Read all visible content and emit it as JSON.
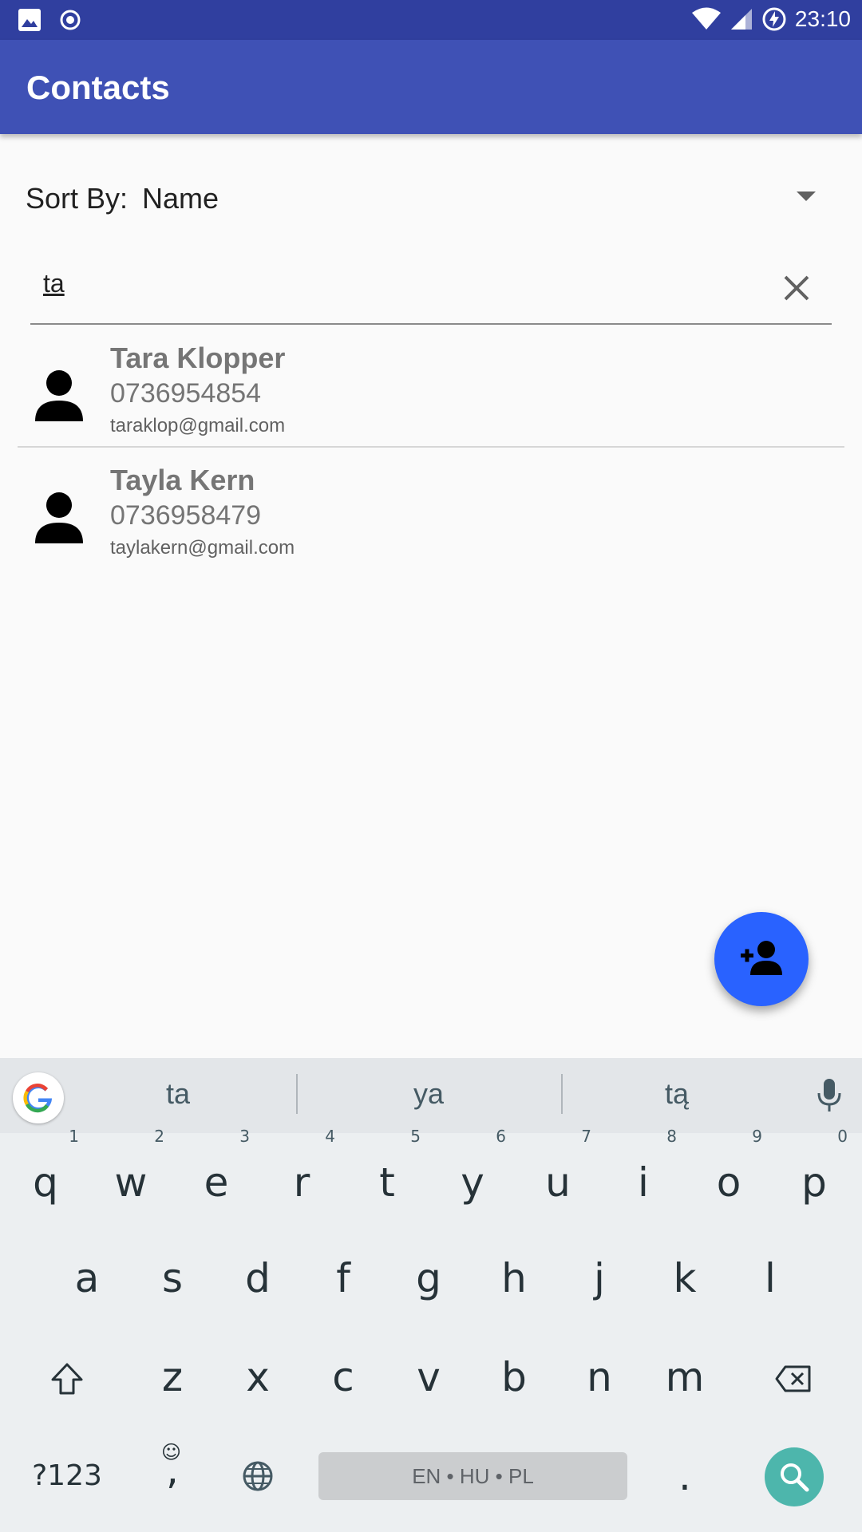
{
  "status_bar": {
    "time": "23:10",
    "left_icons": [
      "gallery-icon",
      "radio-record-icon"
    ],
    "right_icons": [
      "wifi-icon",
      "signal-icon",
      "battery-charging-icon"
    ]
  },
  "app_bar": {
    "title": "Contacts"
  },
  "sort": {
    "label": "Sort By:",
    "value": "Name"
  },
  "search": {
    "value": "ta"
  },
  "contacts": [
    {
      "name": "Tara Klopper",
      "phone": "0736954854",
      "email": "taraklop@gmail.com"
    },
    {
      "name": "Tayla Kern",
      "phone": "0736958479",
      "email": "taylakern@gmail.com"
    }
  ],
  "fab": {
    "icon": "add-person-icon",
    "color": "#2962ff"
  },
  "keyboard": {
    "suggestions": [
      "ta",
      "ya",
      "tą"
    ],
    "row1": [
      "q",
      "w",
      "e",
      "r",
      "t",
      "y",
      "u",
      "i",
      "o",
      "p"
    ],
    "row1_numbers": [
      "1",
      "2",
      "3",
      "4",
      "5",
      "6",
      "7",
      "8",
      "9",
      "0"
    ],
    "row2": [
      "a",
      "s",
      "d",
      "f",
      "g",
      "h",
      "j",
      "k",
      "l"
    ],
    "row3": [
      "z",
      "x",
      "c",
      "v",
      "b",
      "n",
      "m"
    ],
    "symbols_key": "?123",
    "comma_key": ",",
    "space_label": "EN • HU • PL",
    "period_key": "."
  },
  "colors": {
    "status_bar": "#303f9f",
    "app_bar": "#3f51b5",
    "search_key": "#4db6ac"
  }
}
